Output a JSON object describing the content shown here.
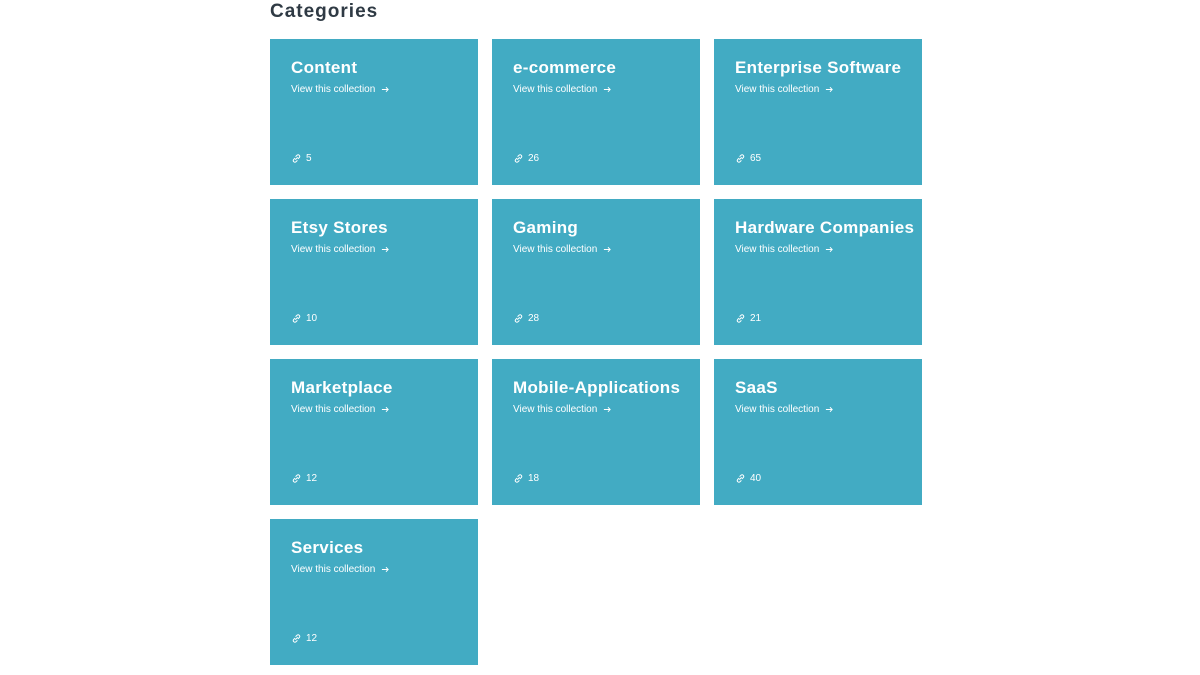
{
  "page": {
    "title": "Categories"
  },
  "categories": [
    {
      "name": "Content",
      "link_label": "View this collection",
      "count": "5"
    },
    {
      "name": "e-commerce",
      "link_label": "View this collection",
      "count": "26"
    },
    {
      "name": "Enterprise Software",
      "link_label": "View this collection",
      "count": "65"
    },
    {
      "name": "Etsy Stores",
      "link_label": "View this collection",
      "count": "10"
    },
    {
      "name": "Gaming",
      "link_label": "View this collection",
      "count": "28"
    },
    {
      "name": "Hardware Companies",
      "link_label": "View this collection",
      "count": "21"
    },
    {
      "name": "Marketplace",
      "link_label": "View this collection",
      "count": "12"
    },
    {
      "name": "Mobile-Applications",
      "link_label": "View this collection",
      "count": "18"
    },
    {
      "name": "SaaS",
      "link_label": "View this collection",
      "count": "40"
    },
    {
      "name": "Services",
      "link_label": "View this collection",
      "count": "12"
    }
  ],
  "icons": {
    "arrow": "arrow-right-icon",
    "count": "link-icon"
  },
  "colors": {
    "card_background": "#42abc3",
    "card_text": "#ffffff",
    "heading": "#2f3a44"
  }
}
